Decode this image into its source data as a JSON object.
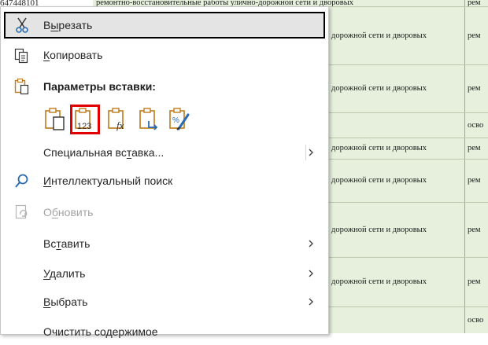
{
  "sheet": {
    "cell_a_top": "647448101",
    "row_first_c": "ремонтно-восстановительные работы улично-дорожной сети и дворовых",
    "row_first_d": "рем",
    "rows": [
      {
        "c": "дорожной сети и дворовых",
        "d": "рем"
      },
      {
        "c": "дорожной сети и дворовых",
        "d": "рем"
      },
      {
        "c": "",
        "d": "осво"
      },
      {
        "c": "дорожной сети и дворовых",
        "d": "рем"
      },
      {
        "c": "дорожной сети и дворовых",
        "d": "рем"
      },
      {
        "c": "дорожной сети и дворовых",
        "d": "рем"
      },
      {
        "c": "дорожной сети и дворовых",
        "d": "рем"
      },
      {
        "c": "",
        "d": "осво"
      }
    ]
  },
  "menu": {
    "cut": {
      "pre": "В",
      "u": "ы",
      "post": "резать"
    },
    "copy": {
      "pre": "",
      "u": "К",
      "post": "опировать"
    },
    "paste_options_label": "Параметры вставки:",
    "paste_special": {
      "pre": "Специальная вс",
      "u": "т",
      "post": "авка..."
    },
    "smart_lookup": {
      "pre": "",
      "u": "И",
      "post": "нтеллектуальный поиск"
    },
    "refresh": {
      "pre": "О",
      "u": "б",
      "post": "новить"
    },
    "insert": {
      "pre": "Вс",
      "u": "т",
      "post": "авить"
    },
    "delete": {
      "pre": "",
      "u": "У",
      "post": "далить"
    },
    "select": {
      "pre": "",
      "u": "В",
      "post": "ыбрать"
    },
    "clear_contents": "Очистить содержимое",
    "paste_values_text": "123",
    "paste_formulas_text": "fx"
  },
  "colors": {
    "accent_red": "#e00000",
    "icon_orange": "#c07a1b",
    "icon_blue": "#2b6cb0"
  }
}
